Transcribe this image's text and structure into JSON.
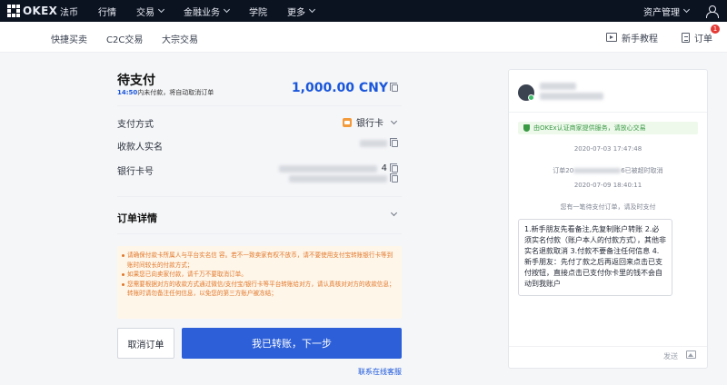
{
  "topnav": {
    "brand": "OKEX",
    "items": [
      {
        "label": "法币",
        "dropdown": false
      },
      {
        "label": "行情",
        "dropdown": false
      },
      {
        "label": "交易",
        "dropdown": true
      },
      {
        "label": "金融业务",
        "dropdown": true
      },
      {
        "label": "学院",
        "dropdown": false
      },
      {
        "label": "更多",
        "dropdown": true
      }
    ],
    "asset_management": "资产管理"
  },
  "subnav": {
    "tabs": [
      "快捷买卖",
      "C2C交易",
      "大宗交易"
    ],
    "tutorial": "新手教程",
    "orders": "订单",
    "orders_badge": "1"
  },
  "order": {
    "title": "待支付",
    "timer_value": "14:50",
    "timer_text": "内未付款，将自动取消订单",
    "amount": "1,000.00 CNY",
    "payment_method_label": "支付方式",
    "payment_method_value": "银行卡",
    "payee_name_label": "收款人实名",
    "bank_card_label": "银行卡号",
    "bank_card_tail": "4",
    "details_label": "订单详情",
    "notices": [
      "请确保付款卡所属人与平台实名信                  容。若不一致卖家有权不放币，请不要使用支付宝转账银行卡等到账时间较长的付款方式；",
      "如果您已向卖家付款，请千万不要取消订单。",
      "您需要根据对方的收款方式通过微信/支付宝/银行卡等平台转账给对方，请认真核对对方的收款信息；转账时请勿备注任何信息，以免您的第三方账户被冻结；"
    ],
    "cancel_button": "取消订单",
    "confirm_button": "我已转账，下一步",
    "support_link": "联系在线客服"
  },
  "chat": {
    "verify_text": "由OKEx认证商家提供服务，请放心交易",
    "sys_time_1": "2020-07-03 17:47:48",
    "sys_cancel_prefix": "订单20",
    "sys_cancel_suffix": "6已被超时取消",
    "sys_time_2": "2020-07-09 18:40:11",
    "sys_pending": "您有一笔待支付订单，请及时支付",
    "merchant_message": "1.新手朋友先看备注,先复制账户转账 2.必须实名付款（账户本人的付款方式），其他非实名退款取消 3.付款不要备注任何信息 4.新手朋友：先付了款之后再返回来点击已支付按钮，直接点击已支付你卡里的钱不会自动到我账户",
    "send_label": "发送"
  }
}
